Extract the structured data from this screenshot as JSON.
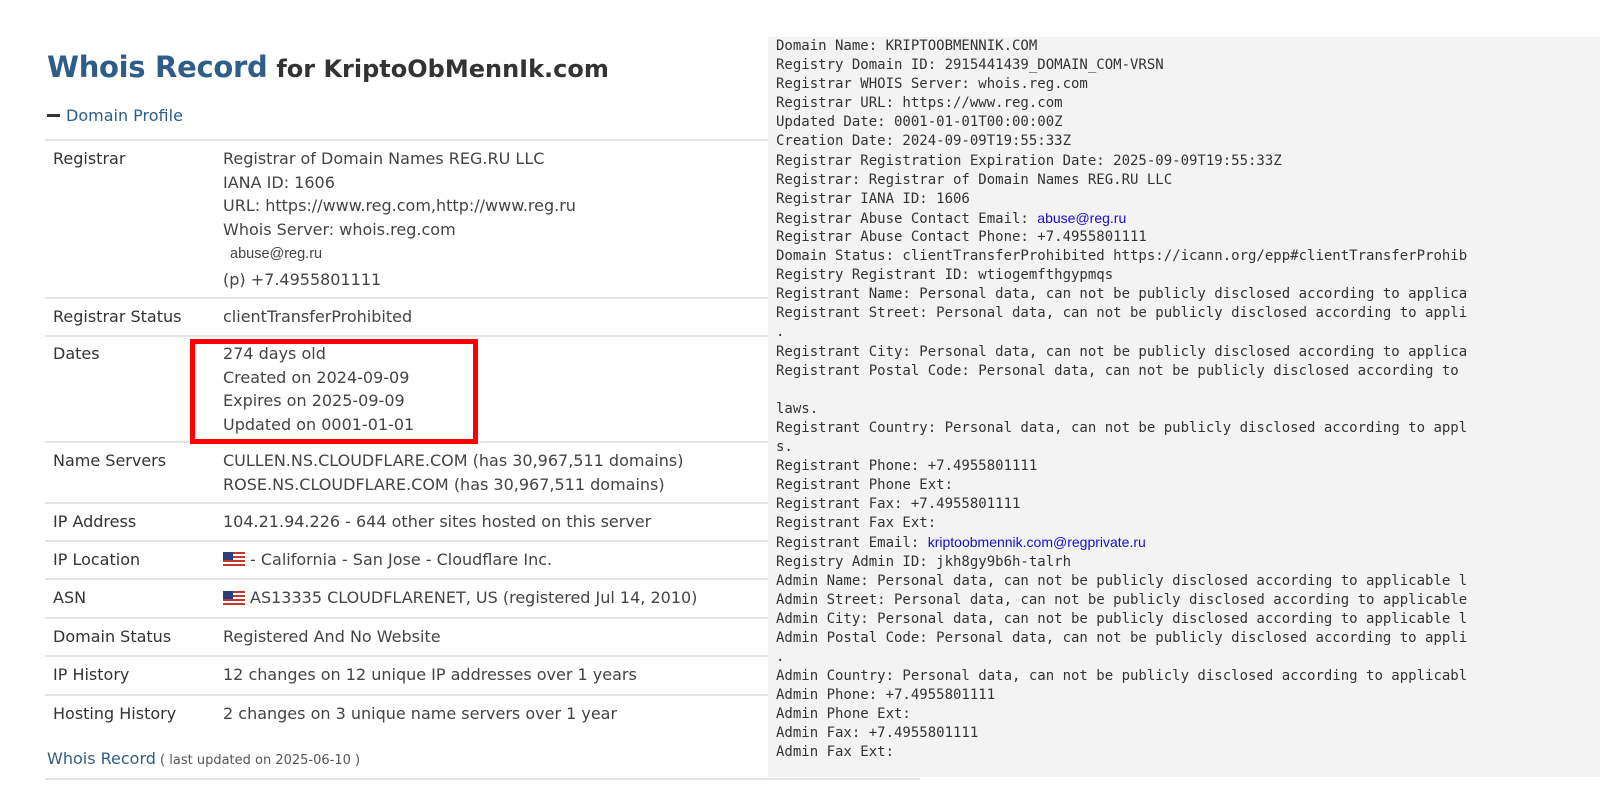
{
  "header": {
    "title_main": "Whois Record",
    "title_for": "for KriptoObMennIk.com"
  },
  "section": {
    "label": "Domain Profile"
  },
  "profile": {
    "registrar": {
      "label": "Registrar",
      "name": "Registrar of Domain Names REG.RU LLC",
      "iana": "IANA ID: 1606",
      "url": "URL: https://www.reg.com,http://www.reg.ru",
      "whois_server": "Whois Server: whois.reg.com",
      "abuse": "abuse@reg.ru",
      "phone": "(p) +7.4955801111"
    },
    "registrar_status": {
      "label": "Registrar Status",
      "value": "clientTransferProhibited"
    },
    "dates": {
      "label": "Dates",
      "age": "274 days old",
      "created": "Created on 2024-09-09",
      "expires": "Expires on 2025-09-09",
      "updated": "Updated on 0001-01-01"
    },
    "name_servers": {
      "label": "Name Servers",
      "ns1": "CULLEN.NS.CLOUDFLARE.COM (has 30,967,511 domains)",
      "ns2": "ROSE.NS.CLOUDFLARE.COM (has 30,967,511 domains)"
    },
    "ip_address": {
      "label": "IP Address",
      "value": "104.21.94.226 - 644 other sites hosted on this server"
    },
    "ip_location": {
      "label": "IP Location",
      "value": "- California - San Jose - Cloudflare Inc."
    },
    "asn": {
      "label": "ASN",
      "value": "AS13335 CLOUDFLARENET, US (registered Jul 14, 2010)"
    },
    "domain_status": {
      "label": "Domain Status",
      "value": "Registered And No Website"
    },
    "ip_history": {
      "label": "IP History",
      "value": "12 changes on 12 unique IP addresses over 1 years"
    },
    "hosting_history": {
      "label": "Hosting History",
      "value": "2 changes on 3 unique name servers over 1 year"
    }
  },
  "footer": {
    "link": "Whois Record",
    "note": " ( last updated on 2025-06-10 )"
  },
  "raw": {
    "lines": [
      {
        "text": "Domain Name: KRIPTOOBMENNIK.COM"
      },
      {
        "text": "Registry Domain ID: 2915441439_DOMAIN_COM-VRSN"
      },
      {
        "text": "Registrar WHOIS Server: whois.reg.com"
      },
      {
        "text": "Registrar URL: https://www.reg.com"
      },
      {
        "text": "Updated Date: 0001-01-01T00:00:00Z"
      },
      {
        "text": "Creation Date: 2024-09-09T19:55:33Z"
      },
      {
        "text": "Registrar Registration Expiration Date: 2025-09-09T19:55:33Z"
      },
      {
        "text": "Registrar: Registrar of Domain Names REG.RU LLC"
      },
      {
        "text": "Registrar IANA ID: 1606"
      },
      {
        "text": "Registrar Abuse Contact Email: ",
        "link": "abuse@reg.ru"
      },
      {
        "text": "Registrar Abuse Contact Phone: +7.4955801111"
      },
      {
        "text": "Domain Status: clientTransferProhibited https://icann.org/epp#clientTransferProhib"
      },
      {
        "text": "Registry Registrant ID: wtiogemfthgypmqs"
      },
      {
        "text": "Registrant Name: Personal data, can not be publicly disclosed according to applica"
      },
      {
        "text": "Registrant Street: Personal data, can not be publicly disclosed according to appli"
      },
      {
        "text": "."
      },
      {
        "text": "Registrant City: Personal data, can not be publicly disclosed according to applica"
      },
      {
        "text": "Registrant Postal Code: Personal data, can not be publicly disclosed according to"
      },
      {
        "text": ""
      },
      {
        "text": "laws."
      },
      {
        "text": "Registrant Country: Personal data, can not be publicly disclosed according to appl"
      },
      {
        "text": "s."
      },
      {
        "text": "Registrant Phone: +7.4955801111"
      },
      {
        "text": "Registrant Phone Ext:"
      },
      {
        "text": "Registrant Fax: +7.4955801111"
      },
      {
        "text": "Registrant Fax Ext:"
      },
      {
        "text": "Registrant Email: ",
        "link": "kriptoobmennik.com@regprivate.ru"
      },
      {
        "text": "Registry Admin ID: jkh8gy9b6h-talrh"
      },
      {
        "text": "Admin Name: Personal data, can not be publicly disclosed according to applicable l"
      },
      {
        "text": "Admin Street: Personal data, can not be publicly disclosed according to applicable"
      },
      {
        "text": "Admin City: Personal data, can not be publicly disclosed according to applicable l"
      },
      {
        "text": "Admin Postal Code: Personal data, can not be publicly disclosed according to appli"
      },
      {
        "text": "."
      },
      {
        "text": "Admin Country: Personal data, can not be publicly disclosed according to applicabl"
      },
      {
        "text": "Admin Phone: +7.4955801111"
      },
      {
        "text": "Admin Phone Ext:"
      },
      {
        "text": "Admin Fax: +7.4955801111"
      },
      {
        "text": "Admin Fax Ext:"
      }
    ]
  },
  "colors": {
    "title": "#2f5d8a",
    "highlight": "#ff0000",
    "link": "#1a0dcc",
    "raw_bg": "#f3f3f3"
  },
  "icons": {
    "section_toggle": "minus-icon",
    "location_flag": "flag-icon"
  }
}
